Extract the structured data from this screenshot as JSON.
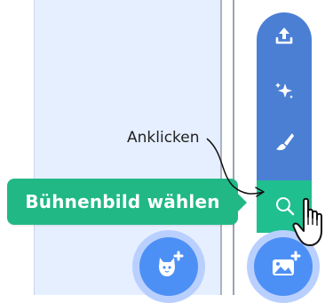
{
  "tooltip": {
    "label": "Bühnenbild wählen"
  },
  "callout": {
    "label": "Anklicken"
  },
  "menu": {
    "items": [
      {
        "name": "upload-backdrop",
        "icon": "upload-icon"
      },
      {
        "name": "surprise",
        "icon": "sparkle-icon"
      },
      {
        "name": "paint",
        "icon": "paintbrush-icon"
      },
      {
        "name": "choose-backdrop-search",
        "icon": "search-icon",
        "selected": true
      }
    ]
  },
  "buttons": {
    "sprite": {
      "icon": "cat-plus-icon"
    },
    "backdrop": {
      "icon": "image-plus-icon"
    }
  },
  "colors": {
    "menu_blue": "#4a7fd4",
    "selected_green": "#1fbf8f",
    "tooltip_green": "#21b886",
    "fab_blue": "#4d90f5",
    "fab_ring": "#b9d0ff",
    "stage_bg": "#e6efff"
  }
}
